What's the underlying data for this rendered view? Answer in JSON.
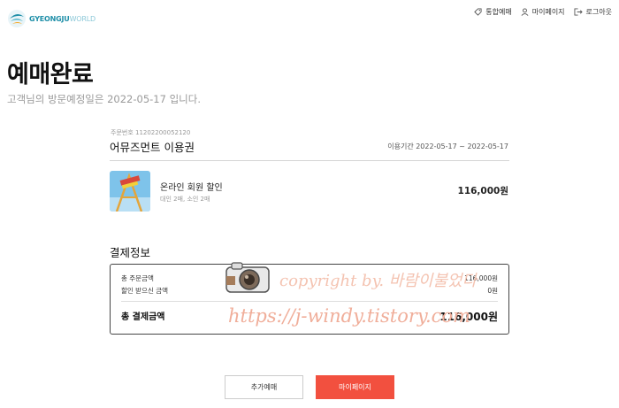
{
  "header": {
    "logo_text_a": "GYEONGJU",
    "logo_text_b": "WORLD",
    "nav": [
      {
        "label": "통합예매",
        "icon": "tag-icon"
      },
      {
        "label": "마이페이지",
        "icon": "user-icon"
      },
      {
        "label": "로그아웃",
        "icon": "logout-icon"
      }
    ]
  },
  "main": {
    "title": "예매완료",
    "visit_text": "고객님의 방문예정일은 2022-05-17 입니다."
  },
  "order": {
    "order_no": "주문번호 11202200052120",
    "product_title": "어뮤즈먼트 이용권",
    "period": "이용기간 2022-05-17 ~ 2022-05-17",
    "item": {
      "name": "온라인 회원 할인",
      "sub": "대인 2매, 소인 2매",
      "price": "116,000원"
    }
  },
  "payment": {
    "heading": "결제정보",
    "rows": [
      {
        "label": "총 주문금액",
        "value": "116,000원"
      },
      {
        "label": "할인 받으신 금액",
        "value": "0원"
      }
    ],
    "total_label": "총 결제금액",
    "total_value": "116,000원"
  },
  "buttons": {
    "add_label": "추가예매",
    "mypage_label": "마이페이지"
  },
  "watermark": {
    "line1": "copyright by. 바람이불었다",
    "line2": "https://j-windy.tistory.com"
  },
  "colors": {
    "accent": "#f2503f",
    "logo_primary": "#1f8fa8",
    "muted_text": "#9a9a9a"
  }
}
